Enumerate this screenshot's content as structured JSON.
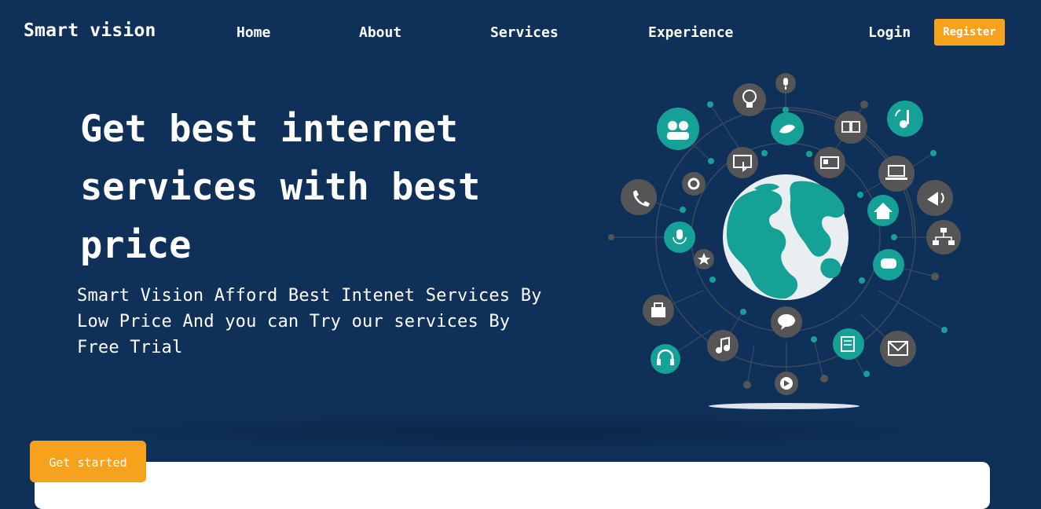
{
  "nav": {
    "brand": "Smart vision",
    "links": [
      "Home",
      "About",
      "Services",
      "Experience"
    ],
    "login": "Login",
    "register": "Register"
  },
  "hero": {
    "title_lines": [
      "Get best internet",
      "services with best",
      "price"
    ],
    "subtitle_lines": [
      "Smart Vision Afford Best Intenet Services By",
      "Low Price And you can Try our services By",
      "Free Trial"
    ],
    "cta": "Get started"
  },
  "colors": {
    "background": "#0f3159",
    "accent": "#f7a21c",
    "teal": "#16a196",
    "gray_icon": "#555555"
  },
  "illustration": {
    "icons": [
      "microphone-icon",
      "lightbulb-icon",
      "people-icon",
      "bird-icon",
      "book-icon",
      "music-note-icon",
      "touch-screen-icon",
      "id-card-icon",
      "laptop-icon",
      "gear-icon",
      "phone-icon",
      "megaphone-icon",
      "home-icon",
      "network-icon",
      "podcast-mic-icon",
      "star-icon",
      "chat-icon",
      "shopping-bag-icon",
      "speech-bubble-icon",
      "music-icon",
      "notes-icon",
      "mail-icon",
      "headphones-icon",
      "play-icon",
      "globe-icon"
    ]
  }
}
